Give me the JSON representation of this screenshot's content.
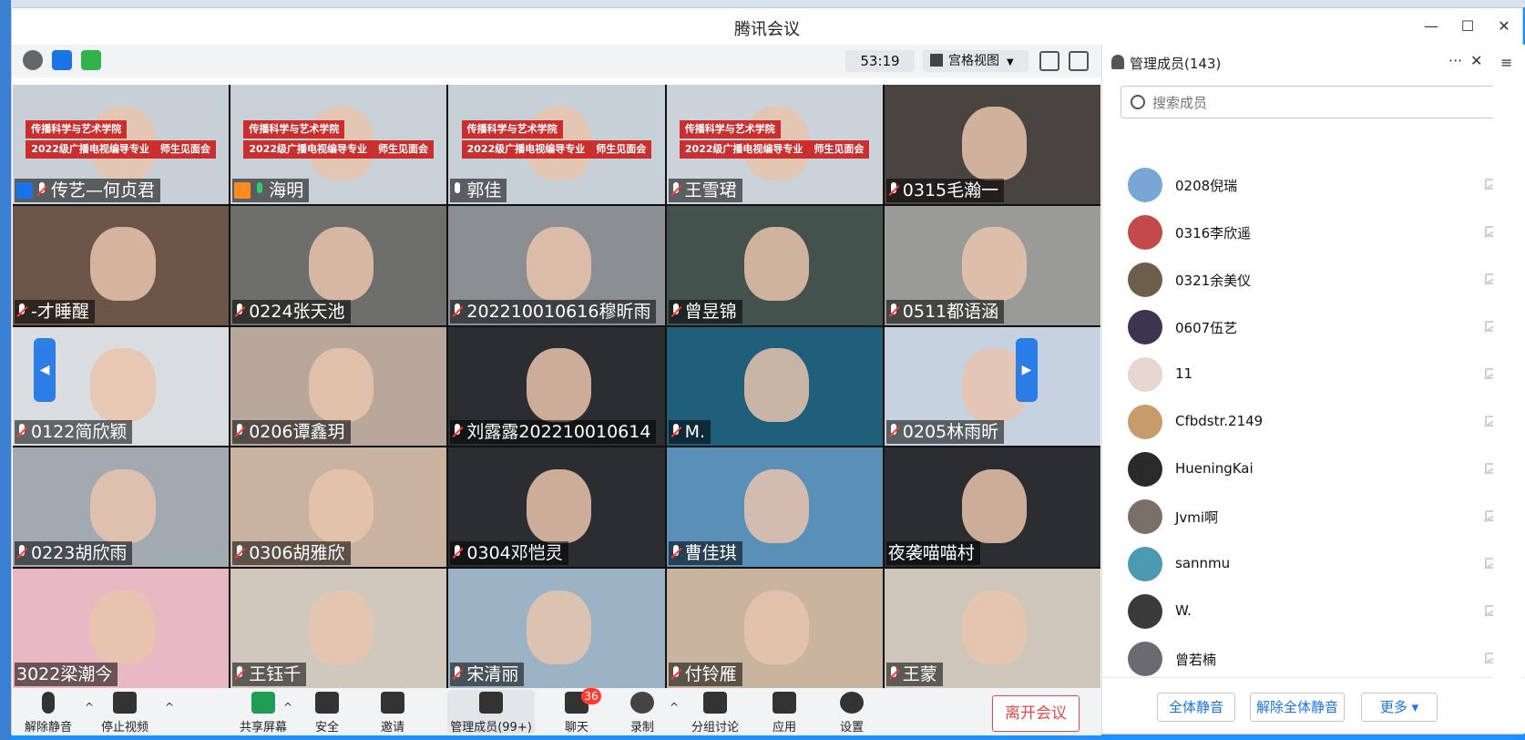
{
  "window": {
    "title": "腾讯会议",
    "controls": [
      "—",
      "☐",
      "✕"
    ]
  },
  "toolbar": {
    "timer": "53:19",
    "view_label": "宫格视图"
  },
  "tiles": [
    {
      "name": "传艺—何贞君",
      "mic": "muted",
      "host": "blue",
      "bg": "#c8cfd6",
      "banner": [
        "传播科学与艺术学院",
        "2022级广播电视编导专业",
        "师生见面会"
      ]
    },
    {
      "name": "海明",
      "mic": "green",
      "host": "orange",
      "bg": "#c9d0d8",
      "banner": [
        "传播科学与艺术学院",
        "2022级广播电视编导专业",
        "师生见面会"
      ]
    },
    {
      "name": "郭佳",
      "mic": "on",
      "host": "",
      "bg": "#c7cfd7",
      "banner": [
        "传播科学与艺术学院",
        "2022级广播电视编导专业",
        "师生见面会"
      ]
    },
    {
      "name": "王雪珺",
      "mic": "muted",
      "host": "",
      "bg": "#cbd2d9",
      "banner": [
        "传播科学与艺术学院",
        "2022级广播电视编导专业",
        "师生见面会"
      ]
    },
    {
      "name": "0315毛瀚一",
      "mic": "muted",
      "host": "",
      "bg": "#4a4440",
      "banner": []
    },
    {
      "name": "-才睡醒",
      "mic": "muted",
      "host": "",
      "bg": "#6a5548",
      "banner": []
    },
    {
      "name": "0224张天池",
      "mic": "muted",
      "host": "",
      "bg": "#6e6e6c",
      "banner": []
    },
    {
      "name": "202210010616穆昕雨",
      "mic": "muted",
      "host": "",
      "bg": "#8b8f94",
      "banner": []
    },
    {
      "name": "曾昱锦",
      "mic": "muted",
      "host": "",
      "bg": "#44524d",
      "banner": []
    },
    {
      "name": "0511都语涵",
      "mic": "muted",
      "host": "",
      "bg": "#9a9a98",
      "banner": []
    },
    {
      "name": "0122简欣颖",
      "mic": "muted",
      "host": "",
      "bg": "#d9dde0",
      "banner": []
    },
    {
      "name": "0206谭鑫玥",
      "mic": "muted",
      "host": "",
      "bg": "#b8a79a",
      "banner": []
    },
    {
      "name": "刘露露202210010614",
      "mic": "muted",
      "host": "",
      "bg": "#2b2d30",
      "banner": []
    },
    {
      "name": "M.",
      "mic": "muted",
      "host": "",
      "bg": "#1f5f7a",
      "banner": []
    },
    {
      "name": "0205林雨昕",
      "mic": "muted",
      "host": "",
      "bg": "#c7d2e0",
      "banner": []
    },
    {
      "name": "0223胡欣雨",
      "mic": "muted",
      "host": "",
      "bg": "#a3a9b1",
      "banner": []
    },
    {
      "name": "0306胡雅欣",
      "mic": "muted",
      "host": "",
      "bg": "#c9b3a0",
      "banner": []
    },
    {
      "name": "0304邓恺灵",
      "mic": "muted",
      "host": "",
      "bg": "#2b2d30",
      "banner": []
    },
    {
      "name": "曹佳琪",
      "mic": "muted",
      "host": "",
      "bg": "#5a8fb8",
      "banner": []
    },
    {
      "name": "夜袭喵喵村",
      "mic": "none",
      "host": "",
      "bg": "#2b2d30",
      "banner": []
    },
    {
      "name": "3022梁潮今",
      "mic": "none",
      "host": "",
      "bg": "#e8b9c3",
      "banner": []
    },
    {
      "name": "王钰千",
      "mic": "muted",
      "host": "",
      "bg": "#d0c7bd",
      "banner": []
    },
    {
      "name": "宋清丽",
      "mic": "muted",
      "host": "",
      "bg": "#9bb3c5",
      "banner": []
    },
    {
      "name": "付铃雁",
      "mic": "muted",
      "host": "",
      "bg": "#c9b59f",
      "banner": []
    },
    {
      "name": "王蒙",
      "mic": "muted",
      "host": "",
      "bg": "#cfc6bb",
      "banner": []
    }
  ],
  "bottombar": {
    "items": [
      {
        "key": "unmute",
        "label": "解除静音"
      },
      {
        "key": "video",
        "label": "停止视频"
      },
      {
        "key": "share",
        "label": "共享屏幕"
      },
      {
        "key": "security",
        "label": "安全"
      },
      {
        "key": "invite",
        "label": "邀请"
      },
      {
        "key": "members",
        "label": "管理成员(99+)"
      },
      {
        "key": "chat",
        "label": "聊天"
      },
      {
        "key": "record",
        "label": "录制"
      },
      {
        "key": "breakout",
        "label": "分组讨论"
      },
      {
        "key": "apps",
        "label": "应用"
      },
      {
        "key": "settings",
        "label": "设置"
      }
    ],
    "chat_badge": "36",
    "leave_label": "离开会议"
  },
  "panel": {
    "title": "管理成员(143)",
    "more": "···",
    "close": "✕",
    "search_placeholder": "搜索成员",
    "members": [
      {
        "name": "0208倪瑞",
        "avatar_color": "#7aa6d6"
      },
      {
        "name": "0316李欣遥",
        "avatar_color": "#c24a4a"
      },
      {
        "name": "0321余美仪",
        "avatar_color": "#6b5f4b"
      },
      {
        "name": "0607伍艺",
        "avatar_color": "#3b3550"
      },
      {
        "name": "11",
        "avatar_color": "#e6d8d0"
      },
      {
        "name": "Cfbdstr.2149",
        "avatar_color": "#c79c6a"
      },
      {
        "name": "HueningKai",
        "avatar_color": "#2a2a2a"
      },
      {
        "name": "Jvmi啊",
        "avatar_color": "#7a7068"
      },
      {
        "name": "sannmu",
        "avatar_color": "#4c9ab0"
      },
      {
        "name": "W.",
        "avatar_color": "#3a3a3a"
      },
      {
        "name": "曾若楠",
        "avatar_color": "#6b6a70"
      }
    ],
    "footer": {
      "mute_all": "全体静音",
      "unmute_all": "解除全体静音",
      "more": "更多 ▾"
    }
  }
}
